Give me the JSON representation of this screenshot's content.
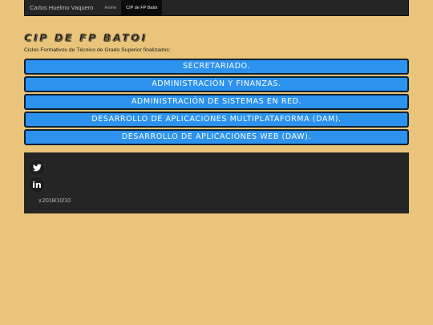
{
  "navbar": {
    "brand": "Carlos Huelmo Vaquero",
    "links": [
      {
        "label": "Home",
        "active": false
      },
      {
        "label": "CIP de FP Batoi",
        "active": true
      }
    ]
  },
  "main": {
    "title": "CIP DE FP BATOI",
    "subtitle": "Ciclos Formativos de Técnico de Grado Superior finalizados:",
    "cycles": [
      "SECRETARIADO.",
      "ADMINISTRACIÓN Y FINANZAS.",
      "ADMINISTRACIÓN DE SISTEMAS EN RED.",
      "DESARROLLO DE APLICACIONES MULTIPLATAFORMA (DAM).",
      "DESARROLLO DE APLICACIONES WEB (DAW)."
    ]
  },
  "footer": {
    "social": [
      {
        "icon": "twitter-icon"
      },
      {
        "icon": "linkedin-icon",
        "glyph": "in"
      }
    ],
    "version": "v.2018/10/10"
  },
  "colors": {
    "background": "#e9c47a",
    "navbar": "#252525",
    "button": "#2c92ee",
    "button_border": "#0f2133",
    "footer": "#252525"
  }
}
